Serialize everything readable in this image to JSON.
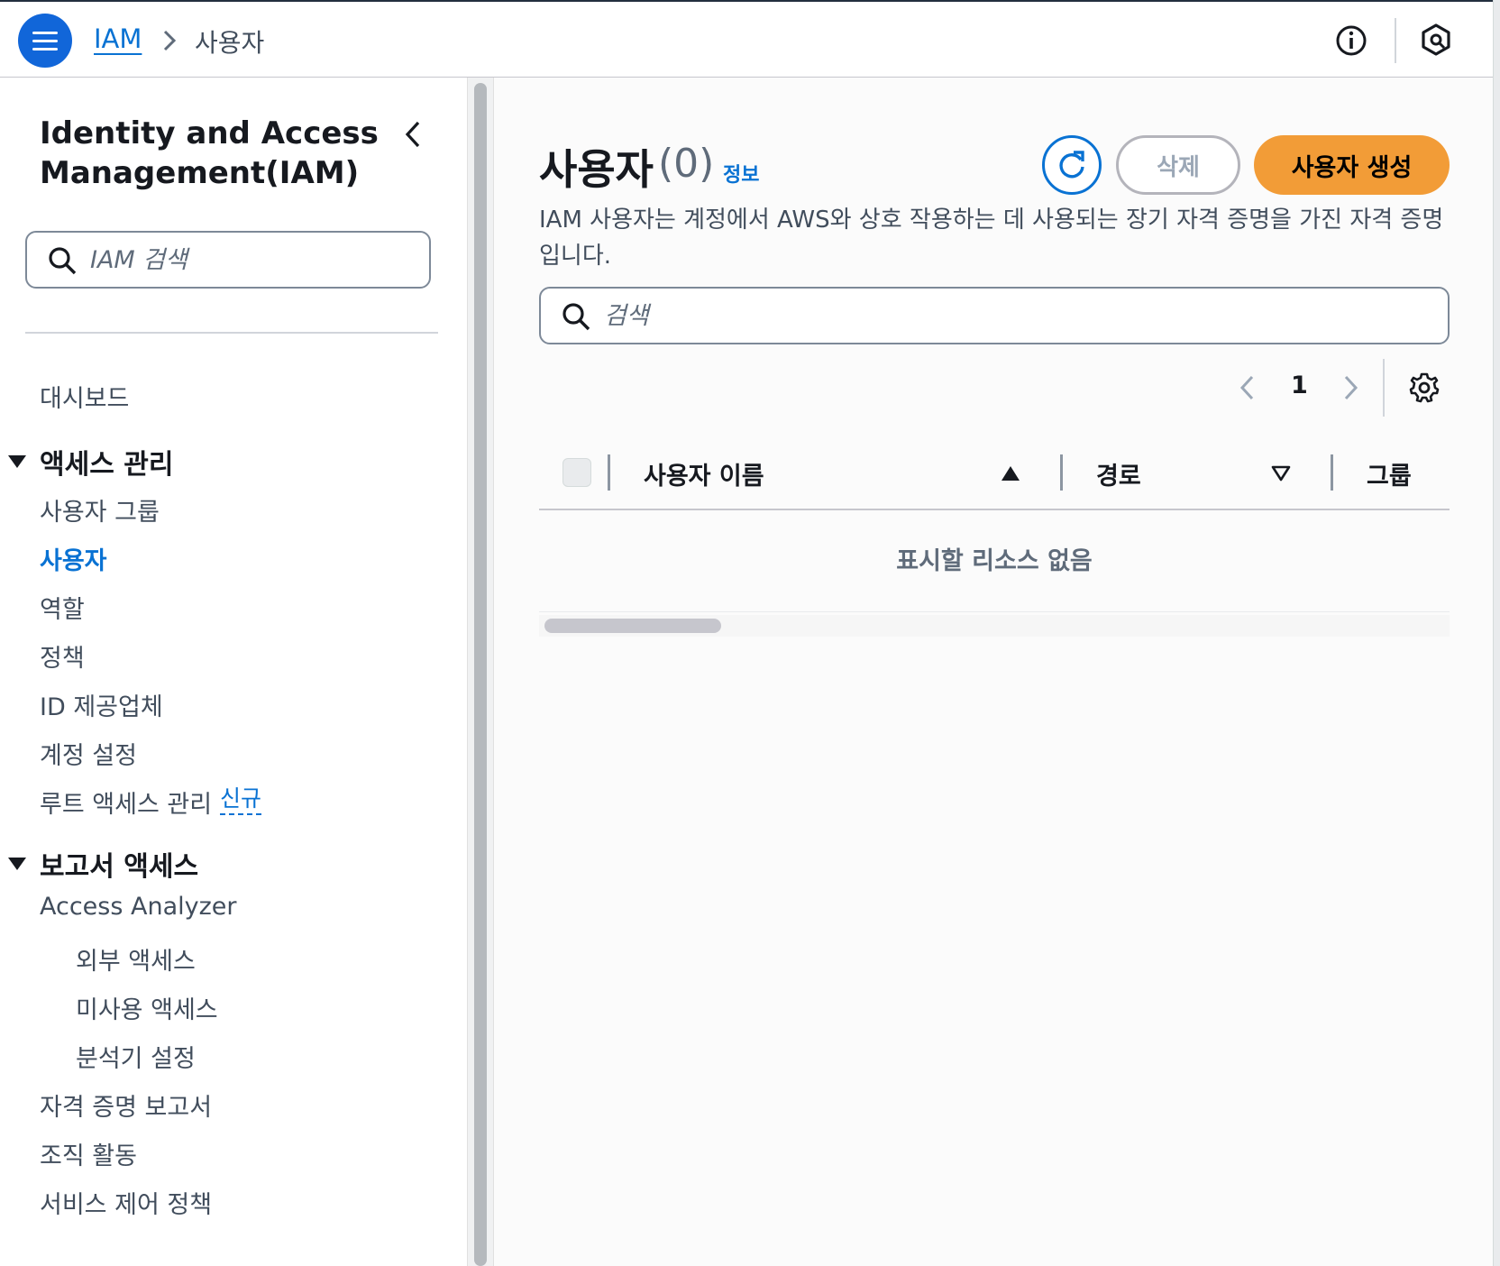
{
  "topbar": {
    "menu_icon": "hamburger-menu-icon",
    "breadcrumb": {
      "service": "IAM",
      "current": "사용자"
    },
    "info_icon": "info-circle-icon",
    "shield_icon": "hexagon-shield-icon"
  },
  "sidebar": {
    "title": "Identity and Access Management(IAM)",
    "search_placeholder": "IAM 검색",
    "dashboard": "대시보드",
    "section_access": "액세스 관리",
    "access_items": [
      "사용자 그룹",
      "사용자",
      "역할",
      "정책",
      "ID 제공업체",
      "계정 설정",
      "루트 액세스 관리"
    ],
    "new_badge": "신규",
    "section_reports": "보고서 액세스",
    "report_items": [
      "Access Analyzer",
      "외부 액세스",
      "미사용 액세스",
      "분석기 설정",
      "자격 증명 보고서",
      "조직 활동",
      "서비스 제어 정책"
    ],
    "active_item": "사용자"
  },
  "main": {
    "title": "사용자",
    "count": "(0)",
    "info_link": "정보",
    "delete_label": "삭제",
    "create_label": "사용자 생성",
    "description": "IAM 사용자는 계정에서 AWS와 상호 작용하는 데 사용되는 장기 자격 증명을 가진 자격 증명입니다.",
    "search_placeholder": "검색",
    "pagination": {
      "page": "1"
    },
    "table": {
      "columns": [
        "사용자 이름",
        "경로",
        "그룹"
      ],
      "sort_column": "사용자 이름",
      "empty_text": "표시할 리소스 없음"
    }
  },
  "colors": {
    "accent_blue": "#0972d3",
    "menu_blue": "#1166d9",
    "primary_orange": "#f29c37"
  }
}
